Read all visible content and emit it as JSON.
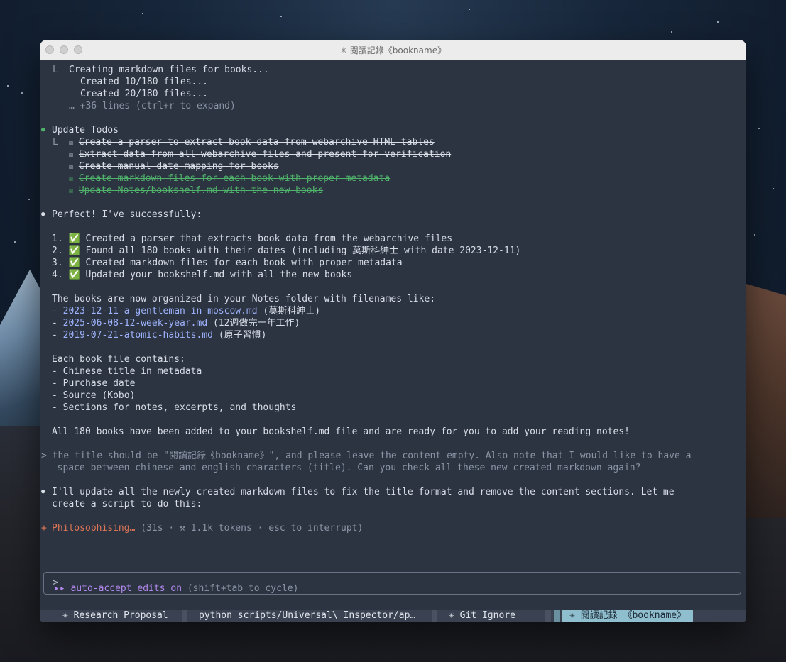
{
  "window": {
    "title": "✳ 閱讀記錄《bookname》"
  },
  "progress": {
    "header": "Creating markdown files for books...",
    "lines": [
      "Created 10/180 files...",
      "Created 20/180 files..."
    ],
    "more": "… +36 lines (ctrl+r to expand)"
  },
  "todos": {
    "title": "Update Todos",
    "items": [
      {
        "text": "Create a parser to extract book data from webarchive HTML tables",
        "state": "done"
      },
      {
        "text": "Extract data from all webarchive files and present for verification",
        "state": "done"
      },
      {
        "text": "Create manual date mapping for books",
        "state": "done"
      },
      {
        "text": "Create markdown files for each book with proper metadata",
        "state": "done-green"
      },
      {
        "text": "Update Notes/bookshelf.md with the new books",
        "state": "done-green"
      }
    ]
  },
  "summary": {
    "intro": "Perfect! I've successfully:",
    "steps": [
      "1. ✅ Created a parser that extracts book data from the webarchive files",
      "2. ✅ Found all 180 books with their dates (including 莫斯科紳士 with date 2023-12-11)",
      "3. ✅ Created markdown files for each book with proper metadata",
      "4. ✅ Updated your bookshelf.md with all the new books"
    ],
    "org_intro": "The books are now organized in your Notes folder with filenames like:",
    "files": [
      {
        "name": "2023-12-11-a-gentleman-in-moscow.md",
        "note": "(莫斯科紳士)"
      },
      {
        "name": "2025-06-08-12-week-year.md",
        "note": "(12週做完一年工作)"
      },
      {
        "name": "2019-07-21-atomic-habits.md",
        "note": "(原子習慣)"
      }
    ],
    "contains_intro": "Each book file contains:",
    "contains": [
      "- Chinese title in metadata",
      "- Purchase date",
      "- Source (Kobo)",
      "- Sections for notes, excerpts, and thoughts"
    ],
    "final": "All 180 books have been added to your bookshelf.md file and are ready for you to add your reading notes!"
  },
  "user_message": {
    "line1": "> the title should be \"閱讀記錄《bookname》\", and please leave the content empty. Also note that I would like to have a",
    "line2": "  space between chinese and english characters (title). Can you check all these new created markdown again?"
  },
  "assistant_reply": {
    "line1": "I'll update all the newly created markdown files to fix the title format and remove the content sections. Let me",
    "line2": "create a script to do this:"
  },
  "status": {
    "activity": "Philosophising…",
    "details": "(31s · ⚒ 1.1k tokens · esc to interrupt)"
  },
  "prompt": {
    "caret": ">"
  },
  "mode": {
    "label": "auto-accept edits on",
    "hint": "(shift+tab to cycle)"
  },
  "tabs": [
    {
      "label": "✳ Research Proposal"
    },
    {
      "label": "python scripts/Universal\\ Inspector/ap…"
    },
    {
      "label": "✳ Git Ignore"
    },
    {
      "label": "✳ 閱讀記錄 《bookname》",
      "active": true
    }
  ],
  "colors": {
    "terminal_bg": "#2c3442",
    "green": "#4fb36a",
    "link": "#9fb4ff",
    "orange": "#e07656",
    "purple": "#b58af0",
    "active_tab": "#8fbfce"
  }
}
